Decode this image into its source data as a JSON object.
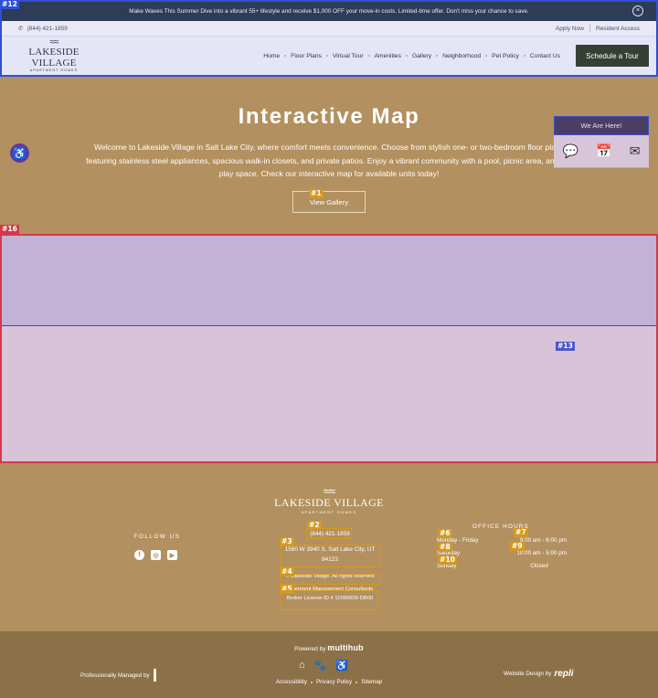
{
  "announcement": {
    "text": "Make Waves This Summer Dive into a vibrant 55+ lifestyle and receive $1,000 OFF your move-in costs. Limited-time offer. Don't miss your chance to save.",
    "close_label": "×"
  },
  "utility": {
    "phone": "(844) 421-1859",
    "links": [
      "Apply Now",
      "Resident Access"
    ]
  },
  "brand": {
    "name": "LAKESIDE VILLAGE",
    "tagline": "APARTMENT HOMES"
  },
  "nav": {
    "items": [
      "Home",
      "Floor Plans",
      "Virtual Tour",
      "Amenities",
      "Gallery",
      "Neighborhood",
      "Pet Policy",
      "Contact Us"
    ],
    "cta": "Schedule a Tour"
  },
  "hero": {
    "title": "Interactive Map",
    "description": "Welcome to Lakeside Village in Salt Lake City, where comfort meets convenience. Choose from stylish one- or two-bedroom floor plans featuring stainless steel appliances, spacious walk-in closets, and private patios. Enjoy a vibrant community with a pool, picnic area, and pet play space. Check our interactive map for available units today!",
    "button": "View Gallery"
  },
  "map_widget": {
    "here_button": "We Are Here!",
    "icons": [
      "chat-icon",
      "calendar-icon",
      "mail-icon"
    ]
  },
  "footer": {
    "follow_label": "FOLLOW US",
    "social": [
      "facebook-icon",
      "instagram-icon",
      "youtube-icon"
    ],
    "phone": "(844) 421-1859",
    "address": "1580 W 3940 S, Salt Lake City, UT 84123",
    "copyright": "© Lakeside Village. All rights reserved",
    "license_line1": "Apartment Management Consultants",
    "license_line2": "Broker License ID # 11066609-DB00",
    "hours_title": "OFFICE HOURS",
    "hours": [
      {
        "day": "Monday - Friday",
        "time": "9:00 am - 6:00 pm"
      },
      {
        "day": "Saturday",
        "time": "10:00 am - 5:00 pm"
      },
      {
        "day": "Sunday",
        "time": "Closed"
      }
    ]
  },
  "bottom": {
    "powered_by": "Powered by",
    "powered_brand": "multihub",
    "managed_by": "Professionally Managed by",
    "links": [
      "Accessibility",
      "Privacy Policy",
      "Sitemap"
    ],
    "design_by": "Website Design by",
    "design_brand": "repli"
  },
  "tags": [
    "#1",
    "#2",
    "#3",
    "#4",
    "#5",
    "#6",
    "#7",
    "#8",
    "#9",
    "#10",
    "#12",
    "#13",
    "#16"
  ]
}
